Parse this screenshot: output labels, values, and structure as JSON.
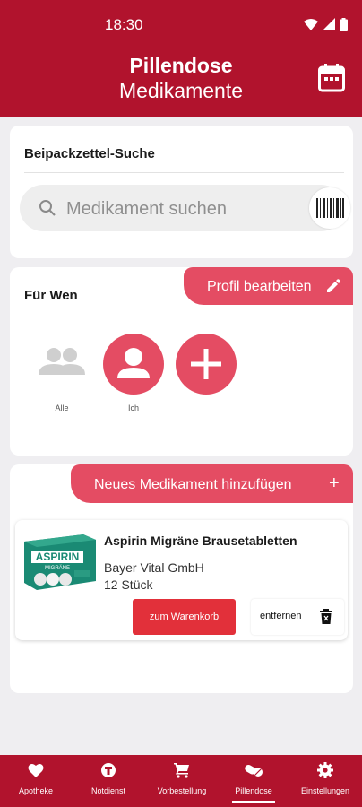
{
  "status_bar": {
    "time": "18:30"
  },
  "header": {
    "title": "Pillendose",
    "subtitle": "Medikamente"
  },
  "search_card": {
    "title": "Beipackzettel-Suche",
    "placeholder": "Medikament suchen"
  },
  "people_card": {
    "title": "Für Wen",
    "edit_profile_label": "Profil bearbeiten",
    "people": [
      {
        "label": "Alle"
      },
      {
        "label": "Ich"
      },
      {
        "label": ""
      }
    ]
  },
  "meds_card": {
    "add_label": "Neues Medikament hinzufügen",
    "add_symbol": "+",
    "items": [
      {
        "name": "Aspirin Migräne Brausetabletten",
        "manufacturer": "Bayer Vital GmbH",
        "quantity": "12 Stück",
        "cart_label": "zum Warenkorb",
        "remove_label": "entfernen",
        "package_brand": "ASPIRIN",
        "package_sub": "MIGRÄNE"
      }
    ]
  },
  "bottom_nav": {
    "items": [
      {
        "label": "Apotheke",
        "icon": "heart-icon"
      },
      {
        "label": "Notdienst",
        "icon": "emergency-icon"
      },
      {
        "label": "Vorbestellung",
        "icon": "cart-icon"
      },
      {
        "label": "Pillendose",
        "icon": "pills-icon",
        "active": true
      },
      {
        "label": "Einstellungen",
        "icon": "gear-icon"
      }
    ]
  },
  "colors": {
    "brand": "#b1132d",
    "accent": "#e44c63",
    "cart_button": "#e2303a",
    "background": "#efeef1"
  }
}
